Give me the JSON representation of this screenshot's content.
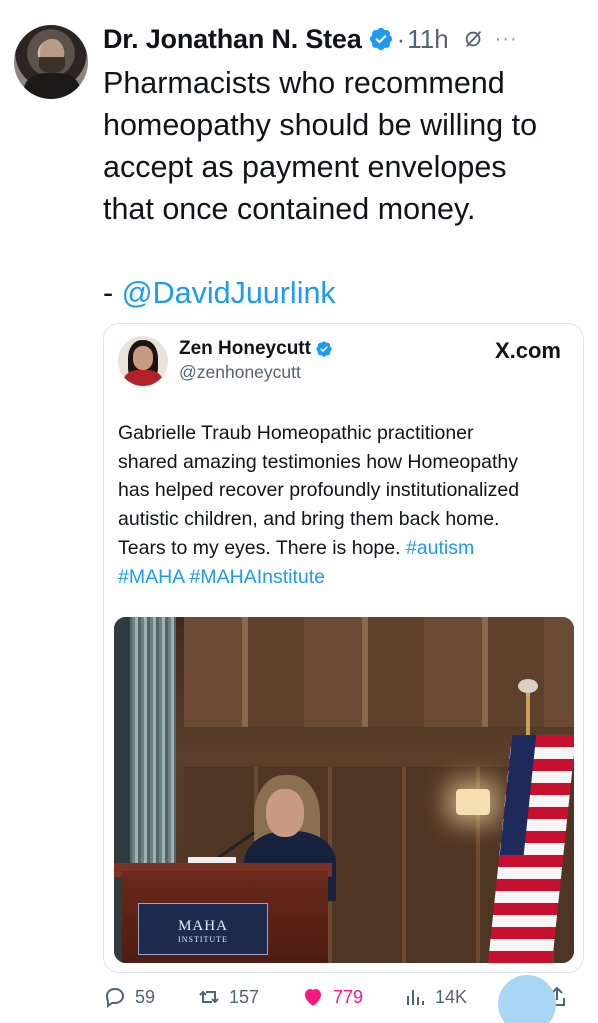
{
  "tweet": {
    "author_name": "Dr. Jonathan N. Stea",
    "time_sep": "·",
    "time": "11h",
    "more": "···",
    "text_lines": [
      "Pharmacists who recommend",
      "homeopathy should be willing to",
      "accept as payment envelopes",
      "that once contained money."
    ],
    "attribution_prefix": "- ",
    "attribution_mention": "@DavidJuurlink"
  },
  "quote": {
    "author_name": "Zen Honeycutt",
    "author_handle": "@zenhoneycutt",
    "source": "X.com",
    "text_lines": [
      "Gabrielle Traub Homeopathic practitioner",
      "shared amazing testimonies how Homeopathy",
      "has helped recover profoundly institutionalized",
      "autistic children, and bring them back home.",
      "Tears to my eyes. There is hope."
    ],
    "hashtags": [
      "#autism",
      "#MAHA",
      "#MAHAInstitute"
    ],
    "podium_text": "MAHA",
    "podium_subtext": "INSTITUTE"
  },
  "actions": {
    "replies": "59",
    "retweets": "157",
    "likes": "779",
    "views": "14K"
  },
  "colors": {
    "accent": "#1d9bf0",
    "like": "#f91880",
    "muted": "#536471"
  },
  "icons": [
    "verified-badge-icon",
    "grok-icon",
    "more-icon",
    "reply-icon",
    "retweet-icon",
    "like-icon",
    "views-icon",
    "bookmark-icon",
    "share-icon"
  ]
}
